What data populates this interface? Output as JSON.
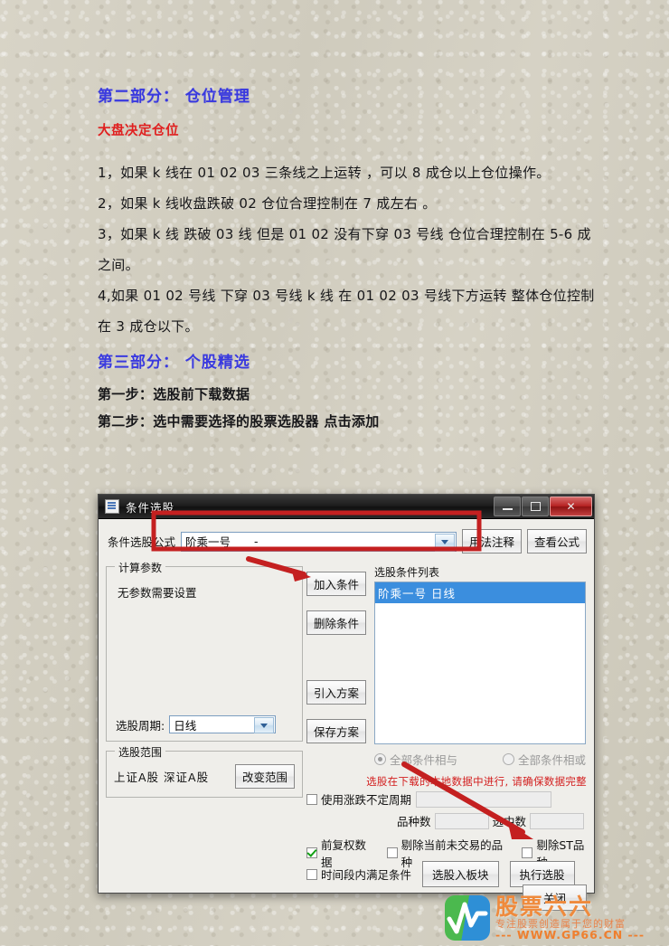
{
  "article": {
    "section2_title": "第二部分： 仓位管理",
    "section2_sub": "大盘决定仓位",
    "paragraphs": [
      "1，如果 k 线在 01  02  03  三条线之上运转 ，可以 8 成仓以上仓位操作。",
      "2，如果 k 线收盘跌破 02  仓位合理控制在 7 成左右 。",
      "3，如果 k 线  跌破  03 线  但是  01  02  没有下穿 03 号线  仓位合理控制在  5-6 成之间。",
      "4,如果 01 02  号线  下穿 03 号线  k 线  在 01 02 03  号线下方运转    整体仓位控制在 3 成仓以下。"
    ],
    "section3_title": "第三部分： 个股精选",
    "steps": [
      "第一步：选股前下载数据",
      "第二步：选中需要选择的股票选股器 点击添加"
    ]
  },
  "dialog": {
    "title": "条件选股",
    "window_buttons": {
      "minimize": "—",
      "maximize": "□",
      "close": "✕"
    },
    "formula": {
      "label": "条件选股公式",
      "value": "阶乘一号",
      "value_dash": "-",
      "btn_usage": "用法注释",
      "btn_view": "查看公式"
    },
    "params_group": {
      "label": "计算参数",
      "note": "无参数需要设置",
      "cycle_label": "选股周期:",
      "cycle_value": "日线"
    },
    "range_group": {
      "label": "选股范围",
      "value": "上证A股  深证A股",
      "btn_change": "改变范围"
    },
    "mid_buttons": [
      "加入条件",
      "删除条件",
      "引入方案",
      "保存方案"
    ],
    "condition_list": {
      "title": "选股条件列表",
      "items": [
        "阶乘一号   日线"
      ]
    },
    "radios": {
      "and_label": "全部条件相与",
      "or_label": "全部条件相或",
      "selected": "全部条件相与"
    },
    "warning": "选股在下载的本地数据中进行, 请确保数据完整",
    "uncertain_cycle_label": "使用涨跌不定周期",
    "counts": {
      "total_label": "品种数",
      "total_value": "",
      "selected_label": "选中数",
      "selected_value": ""
    },
    "checkboxes": {
      "fuquan": {
        "label": "前复权数据",
        "checked": true
      },
      "exclude_untraded": {
        "label": "剔除当前未交易的品种",
        "checked": false
      },
      "exclude_st": {
        "label": "剔除ST品种",
        "checked": false
      },
      "time_range": {
        "label": "时间段内满足条件",
        "checked": false
      },
      "uncertain": {
        "label": "使用涨跌不定周期",
        "checked": false
      }
    },
    "bottom_buttons": {
      "add_to_block": "选股入板块",
      "run_screen": "执行选股",
      "close": "关闭"
    }
  },
  "watermark": {
    "brand": "股票六六",
    "tagline": "专注股票创造属于您的财富",
    "url": "--- WWW.GP66.CN ---"
  },
  "colors": {
    "heading_blue": "#3a3adf",
    "heading_red": "#e02020",
    "annotation_red": "#c42020",
    "selection_blue": "#3b8ede",
    "paper": "#d4d0c2"
  }
}
